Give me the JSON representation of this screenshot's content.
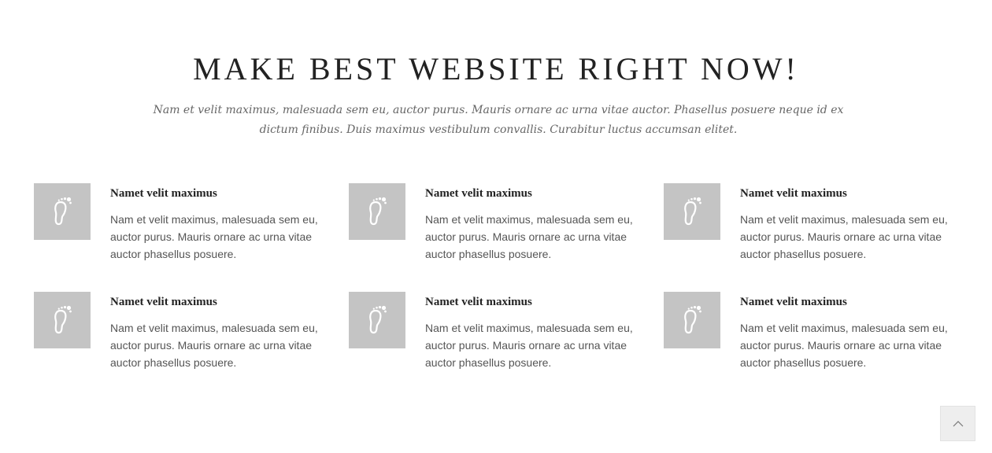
{
  "section": {
    "title": "MAKE BEST WEBSITE RIGHT NOW!",
    "subtitle": "Nam et velit maximus, malesuada sem eu, auctor purus. Mauris ornare ac urna vitae auctor. Phasellus posuere neque id ex dictum finibus. Duis maximus vestibulum convallis. Curabitur luctus accumsan elitet."
  },
  "features": [
    {
      "icon": "footprint-icon",
      "title": "Namet velit maximus",
      "text": "Nam et velit maximus, malesuada sem eu, auctor purus. Mauris ornare ac urna vitae auctor phasellus posuere."
    },
    {
      "icon": "footprint-icon",
      "title": "Namet velit maximus",
      "text": "Nam et velit maximus, malesuada sem eu, auctor purus. Mauris ornare ac urna vitae auctor phasellus posuere."
    },
    {
      "icon": "footprint-icon",
      "title": "Namet velit maximus",
      "text": "Nam et velit maximus, malesuada sem eu, auctor purus. Mauris ornare ac urna vitae auctor phasellus posuere."
    },
    {
      "icon": "footprint-icon",
      "title": "Namet velit maximus",
      "text": "Nam et velit maximus, malesuada sem eu, auctor purus. Mauris ornare ac urna vitae auctor phasellus posuere."
    },
    {
      "icon": "footprint-icon",
      "title": "Namet velit maximus",
      "text": "Nam et velit maximus, malesuada sem eu, auctor purus. Mauris ornare ac urna vitae auctor phasellus posuere."
    },
    {
      "icon": "footprint-icon",
      "title": "Namet velit maximus",
      "text": "Nam et velit maximus, malesuada sem eu, auctor purus. Mauris ornare ac urna vitae auctor phasellus posuere."
    }
  ],
  "scroll_top": {
    "icon": "chevron-up-icon"
  },
  "colors": {
    "icon_tile_bg": "#c4c4c4",
    "title_text": "#222222",
    "body_text": "#555555",
    "subtitle_text": "#666666",
    "scroll_top_bg": "#eeeeee"
  }
}
